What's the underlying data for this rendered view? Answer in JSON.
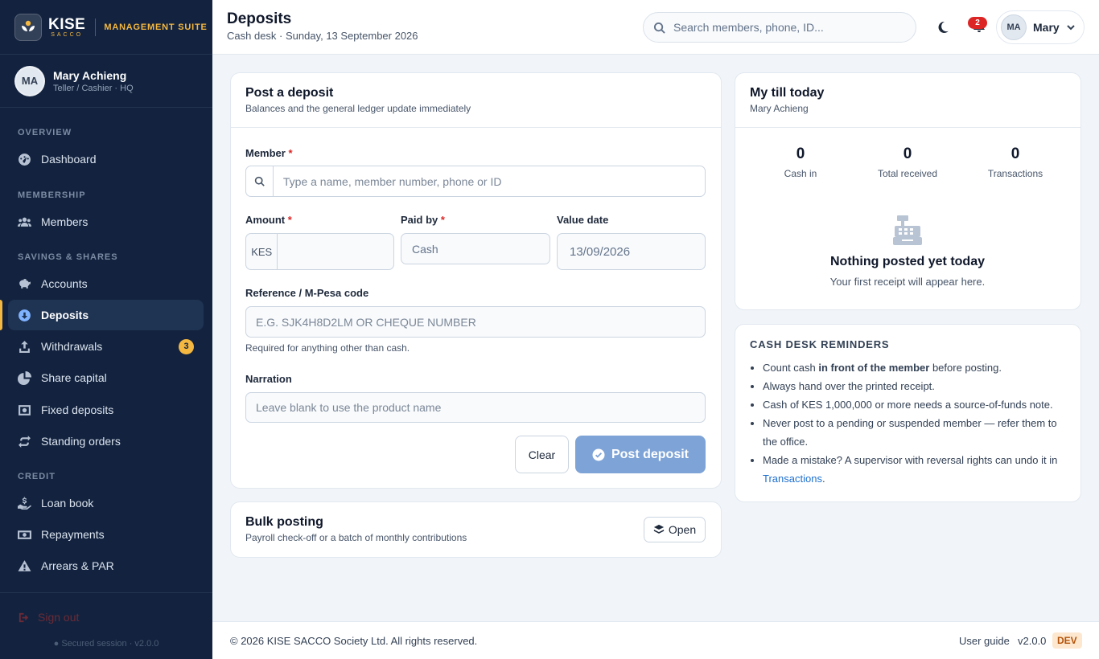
{
  "brand": {
    "name": "KISE",
    "tag": "SACCO",
    "suite": "MANAGEMENT SUITE"
  },
  "user": {
    "initials": "MA",
    "name": "Mary Achieng",
    "role": "Teller / Cashier · HQ",
    "short_name": "Mary"
  },
  "nav": {
    "sections": {
      "overview": "OVERVIEW",
      "membership": "MEMBERSHIP",
      "savings": "SAVINGS & SHARES",
      "credit": "CREDIT"
    },
    "items": {
      "dashboard": "Dashboard",
      "members": "Members",
      "accounts": "Accounts",
      "deposits": "Deposits",
      "withdrawals": "Withdrawals",
      "withdrawals_badge": "3",
      "share_capital": "Share capital",
      "fixed_deposits": "Fixed deposits",
      "standing_orders": "Standing orders",
      "loan_book": "Loan book",
      "repayments": "Repayments",
      "arrears": "Arrears & PAR"
    },
    "sign_out": "Sign out",
    "secured": "Secured session · v2.0.0"
  },
  "header": {
    "title": "Deposits",
    "subtitle": "Cash desk · Sunday, 13 September 2026",
    "search_placeholder": "Search members, phone, ID...",
    "notifications": "2"
  },
  "deposit_form": {
    "title": "Post a deposit",
    "subtitle": "Balances and the general ledger update immediately",
    "member_label": "Member",
    "member_placeholder": "Type a name, member number, phone or ID",
    "amount_label": "Amount",
    "currency": "KES",
    "paid_by_label": "Paid by",
    "paid_by_value": "Cash",
    "value_date_label": "Value date",
    "value_date": "13/09/2026",
    "reference_label": "Reference / M-Pesa code",
    "reference_placeholder": "E.G. SJK4H8D2LM OR CHEQUE NUMBER",
    "reference_help": "Required for anything other than cash.",
    "narration_label": "Narration",
    "narration_placeholder": "Leave blank to use the product name",
    "clear_label": "Clear",
    "post_label": "Post deposit",
    "required_mark": "*"
  },
  "bulk": {
    "title": "Bulk posting",
    "subtitle": "Payroll check-off or a batch of monthly contributions",
    "open_label": "Open"
  },
  "till": {
    "title": "My till today",
    "subtitle": "Mary Achieng",
    "stats": [
      {
        "value": "0",
        "label": "Cash in"
      },
      {
        "value": "0",
        "label": "Total received"
      },
      {
        "value": "0",
        "label": "Transactions"
      }
    ],
    "empty_title": "Nothing posted yet today",
    "empty_sub": "Your first receipt will appear here."
  },
  "reminders": {
    "title": "CASH DESK REMINDERS",
    "r1_a": "Count cash ",
    "r1_b": "in front of the member",
    "r1_c": " before posting.",
    "r2": "Always hand over the printed receipt.",
    "r3": "Cash of KES 1,000,000 or more needs a source-of-funds note.",
    "r4": "Never post to a pending or suspended member — refer them to the office.",
    "r5_a": "Made a mistake? A supervisor with reversal rights can undo it in ",
    "r5_link": "Transactions",
    "r5_c": "."
  },
  "footer": {
    "copyright": "© 2026 KISE SACCO Society Ltd. All rights reserved.",
    "guide": "User guide",
    "version": "v2.0.0",
    "env": "DEV"
  },
  "colors": {
    "sidebar": "#13233f",
    "accent": "#f4b740",
    "primary_disabled": "#7ea3d6",
    "link": "#1d6fcf",
    "danger": "#dc2626"
  }
}
